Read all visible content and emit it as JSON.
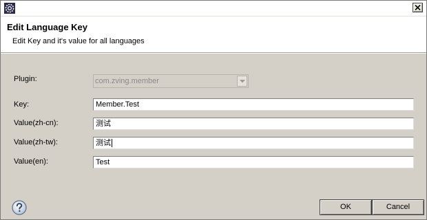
{
  "titlebar": {
    "icon": "eclipse-gear-icon",
    "close_icon": "close-x-icon"
  },
  "header": {
    "title": "Edit Language Key",
    "subtitle": "Edit Key and it's value for all languages"
  },
  "form": {
    "plugin": {
      "label": "Plugin:",
      "value": "com.zving.member",
      "enabled": false
    },
    "key": {
      "label": "Key:",
      "value": "Member.Test"
    },
    "zh_cn": {
      "label": "Value(zh-cn):",
      "value": "测试"
    },
    "zh_tw": {
      "label": "Value(zh-tw):",
      "value": "测试",
      "focused": true
    },
    "en": {
      "label": "Value(en):",
      "value": "Test"
    }
  },
  "footer": {
    "help_icon": "help-question-icon",
    "ok_label": "OK",
    "cancel_label": "Cancel"
  }
}
